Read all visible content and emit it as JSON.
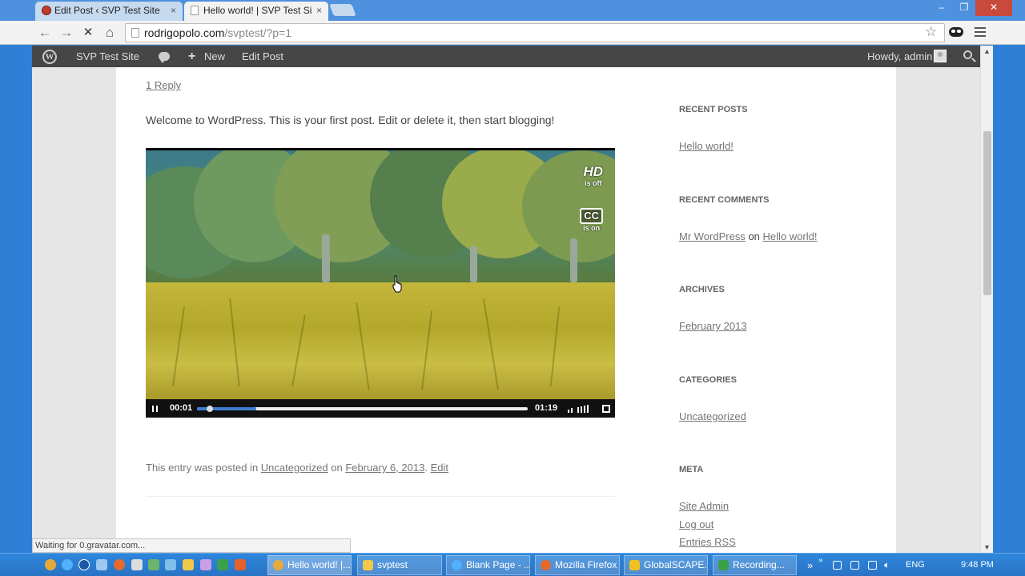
{
  "browser": {
    "tabs": [
      {
        "label": "Edit Post ‹ SVP Test Site — WordPress",
        "active": false
      },
      {
        "label": "Hello world! | SVP Test Site",
        "active": true
      }
    ],
    "close_glyph": "×",
    "url_host": "rodrigopolo.com",
    "url_path": "/svptest/?p=1",
    "nav_icons": [
      "back-icon",
      "forward-icon",
      "stop-icon",
      "home-icon"
    ],
    "window_controls": [
      "minimize-icon",
      "restore-icon",
      "close-icon"
    ]
  },
  "adminbar": {
    "site_name": "SVP Test Site",
    "new_label": "New",
    "new_glyph": "+",
    "edit_post": "Edit Post",
    "howdy": "Howdy, admin",
    "logo_glyph": "W"
  },
  "post": {
    "reply_link": "1 Reply",
    "intro": "Welcome to WordPress. This is your first post. Edit or delete it, then start blogging!",
    "meta_prefix": "This entry was posted in ",
    "meta_category": "Uncategorized",
    "meta_on": " on ",
    "meta_date": "February 6, 2013",
    "meta_sep": ". ",
    "meta_edit": "Edit"
  },
  "video": {
    "hd_label": "HD",
    "hd_state": "is off",
    "cc_label": "CC",
    "cc_state": "is on",
    "current_time": "00:01",
    "duration": "01:19",
    "progress_played": 0.03,
    "progress_loaded": 0.18
  },
  "sidebar": {
    "recent_posts_title": "RECENT POSTS",
    "recent_post": "Hello world!",
    "recent_comments_title": "RECENT COMMENTS",
    "comment_author": "Mr WordPress",
    "comment_on": "on",
    "comment_post": "Hello world!",
    "archives_title": "ARCHIVES",
    "archive": "February 2013",
    "categories_title": "CATEGORIES",
    "category": "Uncategorized",
    "meta_title": "META",
    "meta_links": [
      "Site Admin",
      "Log out",
      "Entries RSS"
    ]
  },
  "status": "Waiting for 0.gravatar.com...",
  "taskbar": {
    "tasks": [
      "Hello world! |...",
      "svptest",
      "Blank Page - ...",
      "Mozilla Firefox",
      "GlobalSCAPE...",
      "Recording..."
    ],
    "overflow": "»",
    "language": "ENG",
    "clock": "9:48 PM"
  },
  "colors": {
    "link": "#757575",
    "adminbar": "#464646",
    "taskbar": "#2a73c4",
    "progress": "#3c7fd1"
  }
}
